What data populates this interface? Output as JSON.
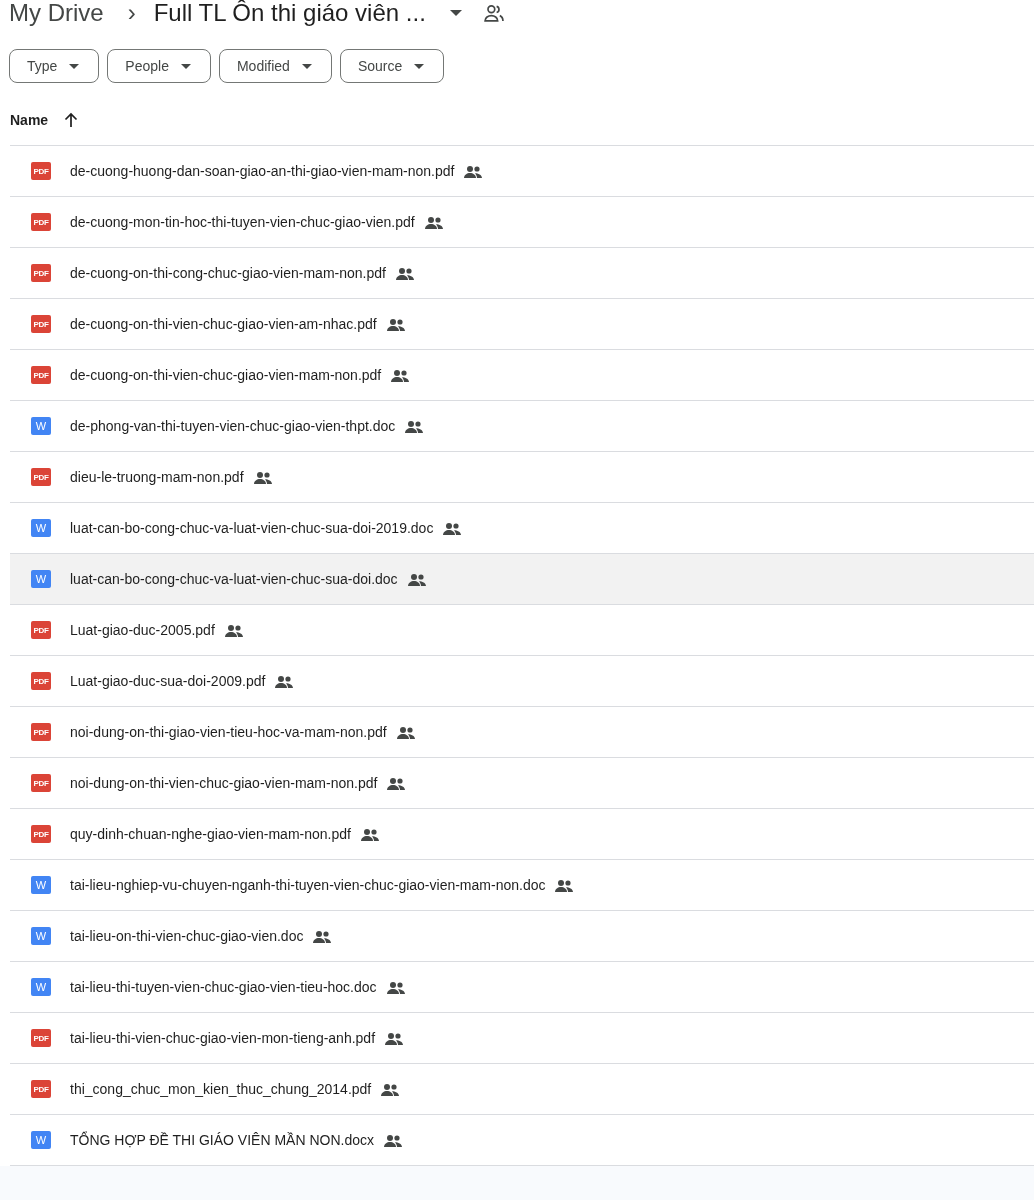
{
  "breadcrumb": {
    "root": "My Drive",
    "separator": "›",
    "folder": "Full TL Ôn thi giáo viên ...",
    "shared": true
  },
  "filters": [
    {
      "label": "Type"
    },
    {
      "label": "People"
    },
    {
      "label": "Modified"
    },
    {
      "label": "Source"
    }
  ],
  "table": {
    "columns": [
      {
        "label": "Name",
        "sorted_ascending": true
      }
    ],
    "rows": [
      {
        "kind": "pdf",
        "icon_text": "PDF",
        "name": "de-cuong-huong-dan-soan-giao-an-thi-giao-vien-mam-non.pdf",
        "shared": true,
        "selected": false
      },
      {
        "kind": "pdf",
        "icon_text": "PDF",
        "name": "de-cuong-mon-tin-hoc-thi-tuyen-vien-chuc-giao-vien.pdf",
        "shared": true,
        "selected": false
      },
      {
        "kind": "pdf",
        "icon_text": "PDF",
        "name": "de-cuong-on-thi-cong-chuc-giao-vien-mam-non.pdf",
        "shared": true,
        "selected": false
      },
      {
        "kind": "pdf",
        "icon_text": "PDF",
        "name": "de-cuong-on-thi-vien-chuc-giao-vien-am-nhac.pdf",
        "shared": true,
        "selected": false
      },
      {
        "kind": "pdf",
        "icon_text": "PDF",
        "name": "de-cuong-on-thi-vien-chuc-giao-vien-mam-non.pdf",
        "shared": true,
        "selected": false
      },
      {
        "kind": "doc",
        "icon_text": "W",
        "name": "de-phong-van-thi-tuyen-vien-chuc-giao-vien-thpt.doc",
        "shared": true,
        "selected": false
      },
      {
        "kind": "pdf",
        "icon_text": "PDF",
        "name": "dieu-le-truong-mam-non.pdf",
        "shared": true,
        "selected": false
      },
      {
        "kind": "doc",
        "icon_text": "W",
        "name": "luat-can-bo-cong-chuc-va-luat-vien-chuc-sua-doi-2019.doc",
        "shared": true,
        "selected": false
      },
      {
        "kind": "doc",
        "icon_text": "W",
        "name": "luat-can-bo-cong-chuc-va-luat-vien-chuc-sua-doi.doc",
        "shared": true,
        "selected": true
      },
      {
        "kind": "pdf",
        "icon_text": "PDF",
        "name": "Luat-giao-duc-2005.pdf",
        "shared": true,
        "selected": false
      },
      {
        "kind": "pdf",
        "icon_text": "PDF",
        "name": "Luat-giao-duc-sua-doi-2009.pdf",
        "shared": true,
        "selected": false
      },
      {
        "kind": "pdf",
        "icon_text": "PDF",
        "name": "noi-dung-on-thi-giao-vien-tieu-hoc-va-mam-non.pdf",
        "shared": true,
        "selected": false
      },
      {
        "kind": "pdf",
        "icon_text": "PDF",
        "name": "noi-dung-on-thi-vien-chuc-giao-vien-mam-non.pdf",
        "shared": true,
        "selected": false
      },
      {
        "kind": "pdf",
        "icon_text": "PDF",
        "name": "quy-dinh-chuan-nghe-giao-vien-mam-non.pdf",
        "shared": true,
        "selected": false
      },
      {
        "kind": "doc",
        "icon_text": "W",
        "name": "tai-lieu-nghiep-vu-chuyen-nganh-thi-tuyen-vien-chuc-giao-vien-mam-non.doc",
        "shared": true,
        "selected": false
      },
      {
        "kind": "doc",
        "icon_text": "W",
        "name": "tai-lieu-on-thi-vien-chuc-giao-vien.doc",
        "shared": true,
        "selected": false
      },
      {
        "kind": "doc",
        "icon_text": "W",
        "name": "tai-lieu-thi-tuyen-vien-chuc-giao-vien-tieu-hoc.doc",
        "shared": true,
        "selected": false
      },
      {
        "kind": "pdf",
        "icon_text": "PDF",
        "name": "tai-lieu-thi-vien-chuc-giao-vien-mon-tieng-anh.pdf",
        "shared": true,
        "selected": false
      },
      {
        "kind": "pdf",
        "icon_text": "PDF",
        "name": "thi_cong_chuc_mon_kien_thuc_chung_2014.pdf",
        "shared": true,
        "selected": false
      },
      {
        "kind": "doc",
        "icon_text": "W",
        "name": "TỔNG HỢP ĐỀ THI GIÁO VIÊN MẦN NON.docx",
        "shared": true,
        "selected": false
      }
    ]
  }
}
